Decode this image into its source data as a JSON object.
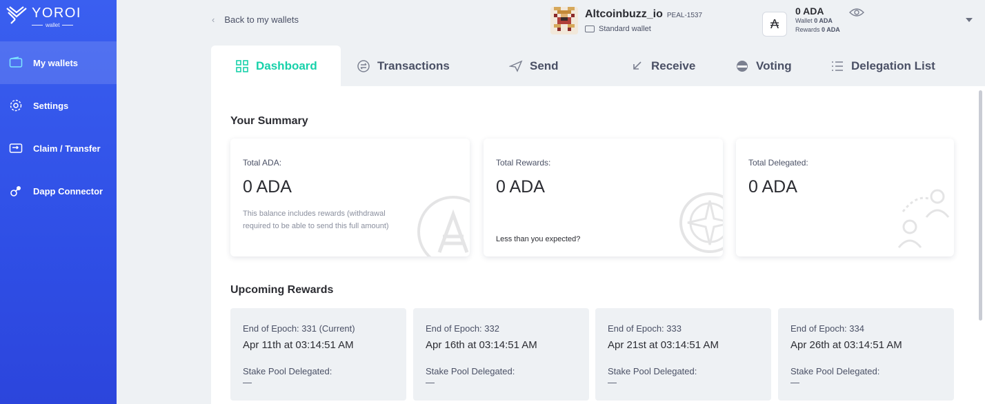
{
  "sidebar": {
    "logo_name": "YOROI",
    "logo_sub": "wallet",
    "items": [
      {
        "label": "My wallets",
        "icon": "wallet-icon",
        "active": true
      },
      {
        "label": "Settings",
        "icon": "gear-icon",
        "active": false
      },
      {
        "label": "Claim / Transfer",
        "icon": "transfer-icon",
        "active": false
      },
      {
        "label": "Dapp Connector",
        "icon": "dapp-icon",
        "active": false
      }
    ]
  },
  "topbar": {
    "back_label": "Back to my wallets",
    "wallet_name": "Altcoinbuzz_io",
    "wallet_plate": "PEAL-1537",
    "wallet_type": "Standard wallet",
    "ada_total": "0 ADA",
    "wallet_label": "Wallet",
    "wallet_amount": "0 ADA",
    "rewards_label": "Rewards",
    "rewards_amount": "0 ADA"
  },
  "tabs": [
    {
      "label": "Dashboard",
      "icon": "dashboard-icon",
      "active": true
    },
    {
      "label": "Transactions",
      "icon": "transactions-icon",
      "active": false
    },
    {
      "label": "Send",
      "icon": "send-icon",
      "active": false
    },
    {
      "label": "Receive",
      "icon": "receive-icon",
      "active": false
    },
    {
      "label": "Voting",
      "icon": "voting-icon",
      "active": false
    },
    {
      "label": "Delegation List",
      "icon": "list-icon",
      "active": false
    }
  ],
  "summary": {
    "title": "Your Summary",
    "cards": [
      {
        "label": "Total ADA:",
        "value": "0 ADA",
        "note": "This balance includes rewards (withdrawal required to be able to send this full amount)"
      },
      {
        "label": "Total Rewards:",
        "value": "0 ADA",
        "link": "Less than you expected?"
      },
      {
        "label": "Total Delegated:",
        "value": "0 ADA"
      }
    ]
  },
  "rewards": {
    "title": "Upcoming Rewards",
    "cards": [
      {
        "epoch": "End of Epoch:  331 (Current)",
        "date": "Apr 11th at 03:14:51 AM",
        "pool_label": "Stake Pool Delegated:",
        "pool_value": "—"
      },
      {
        "epoch": "End of Epoch:  332",
        "date": "Apr 16th at 03:14:51 AM",
        "pool_label": "Stake Pool Delegated:",
        "pool_value": "—"
      },
      {
        "epoch": "End of Epoch:  333",
        "date": "Apr 21st at 03:14:51 AM",
        "pool_label": "Stake Pool Delegated:",
        "pool_value": "—"
      },
      {
        "epoch": "End of Epoch:  334",
        "date": "Apr 26th at 03:14:51 AM",
        "pool_label": "Stake Pool Delegated:",
        "pool_value": "—"
      }
    ]
  },
  "colors": {
    "sidebar": "#3a5ff0",
    "accent": "#17d1aa",
    "background": "#eef1f4"
  }
}
